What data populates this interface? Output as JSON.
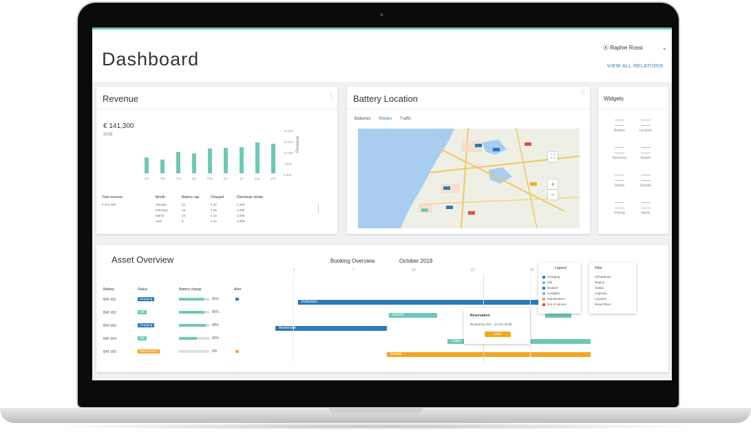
{
  "header": {
    "title": "Dashboard",
    "user": "Ⓐ Raphie Rossi",
    "user_chevron": "⌄",
    "link": "VIEW ALL RELATIONS"
  },
  "revenue": {
    "title": "Revenue",
    "amount": "€ 141,300",
    "sub": "2019",
    "y_ticks": [
      "15.000",
      "12.500",
      "10.000",
      "7.500",
      "5.000"
    ],
    "y_label": "Revenue",
    "x_ticks": [
      "jan",
      "feb",
      "mar",
      "apr",
      "may",
      "jun",
      "jul",
      "aug",
      "sep"
    ],
    "table": {
      "headers": [
        "Total revenue",
        "Month",
        "Battery cap.",
        "Charged",
        "Discharge rebate"
      ],
      "rows": [
        [
          "€ 141.300",
          "January",
          "34",
          "4.32",
          "1.200"
        ],
        [
          "",
          "February",
          "18",
          "4.28",
          "1.080"
        ],
        [
          "",
          "March",
          "12",
          "4.14",
          "1.035"
        ],
        [
          "",
          "April",
          "9",
          "4.12",
          "1.006"
        ]
      ]
    }
  },
  "chart_data": {
    "type": "bar",
    "categories": [
      "jan",
      "feb",
      "mar",
      "apr",
      "may",
      "jun",
      "jul",
      "aug",
      "sep"
    ],
    "values": [
      5600,
      4900,
      7600,
      7000,
      8800,
      8900,
      9100,
      11000,
      10500
    ],
    "ylim": [
      0,
      15000
    ],
    "ylabel": "Revenue",
    "colors": [
      "#6cc9b6"
    ]
  },
  "battery": {
    "title": "Battery Location",
    "filters": [
      "Batteries",
      "Routes",
      "Traffic"
    ],
    "zoom_in": "+",
    "zoom_out": "−",
    "fullscreen": "⛶"
  },
  "widgets": {
    "title": "Widgets",
    "items": [
      "Battery",
      "Location",
      "Revenue",
      "Assets",
      "Status",
      "Routes",
      "Pricing",
      "Alerts"
    ]
  },
  "assets": {
    "title": "Asset Overview",
    "overview_label": "Booking Overview",
    "month": "October 2019",
    "headers": [
      "Battery",
      "Status",
      "Battery charge",
      "",
      "Alert"
    ],
    "rows": [
      {
        "id": "BAT-001",
        "status": "Charging",
        "pct": "82%",
        "charge": 0.82,
        "status_color": "#2a7ab8",
        "alert": "#2a7ab8"
      },
      {
        "id": "BAT-002",
        "status": "Idle",
        "pct": "85%",
        "charge": 0.85,
        "status_color": "#6cc9b6",
        "alert": ""
      },
      {
        "id": "BAT-003",
        "status": "Charging",
        "pct": "88%",
        "charge": 0.88,
        "status_color": "#2a7ab8",
        "alert": ""
      },
      {
        "id": "BAT-004",
        "status": "Idle",
        "pct": "60%",
        "charge": 0.6,
        "status_color": "#6cc9b6",
        "alert": ""
      },
      {
        "id": "BAT-005",
        "status": "Maintenance",
        "pct": "0%",
        "charge": 0.0,
        "status_color": "#f4a623",
        "alert": "#f4a623"
      }
    ],
    "timeline_ticks": [
      "1",
      "7",
      "14",
      "21",
      "28"
    ],
    "gantt": [
      {
        "label": "Rotterdam",
        "color": "#2a7ab8"
      },
      {
        "label": "Utrecht",
        "color": "#6cc9b6"
      },
      {
        "label": "Amsterdam",
        "color": "#2a7ab8"
      },
      {
        "label": "Leiden",
        "color": "#6cc9b6"
      },
      {
        "label": "Service",
        "color": "#f4a623"
      }
    ],
    "tooltip": {
      "title": "Reservation",
      "body": "Booked by Alex - 14 Oct 10:00",
      "button": "VIEW"
    },
    "legend": {
      "title": "Legend",
      "items": [
        "Charging",
        "Idle",
        "Booked",
        "Available",
        "Maintenance",
        "Out of service"
      ]
    },
    "filter_panel": {
      "title": "Filter",
      "items": [
        "All batteries",
        "Region",
        "Status",
        "Capacity",
        "Location",
        "Reset filters"
      ]
    }
  }
}
